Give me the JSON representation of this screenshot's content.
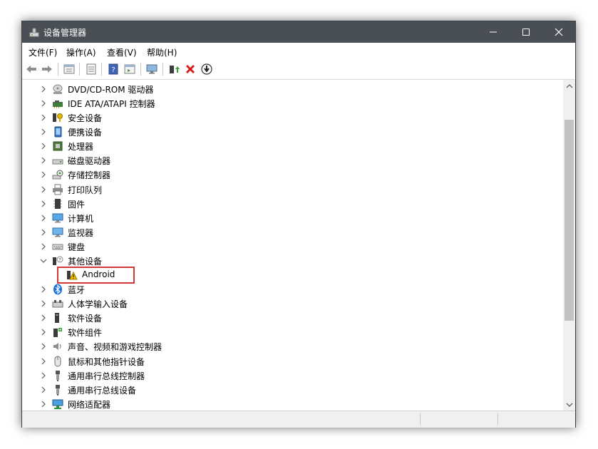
{
  "window": {
    "title": "设备管理器",
    "controls": [
      "minimize",
      "maximize",
      "close"
    ]
  },
  "menu": {
    "items": [
      {
        "label": "文件(F)"
      },
      {
        "label": "操作(A)"
      },
      {
        "label": "查看(V)"
      },
      {
        "label": "帮助(H)"
      }
    ]
  },
  "toolbar": {
    "icons": [
      "back-icon",
      "forward-icon",
      "properties-icon",
      "list-icon",
      "help-icon",
      "show-hide-icon",
      "monitor-scan-icon",
      "update-driver-icon",
      "uninstall-icon",
      "disable-icon"
    ]
  },
  "tree": {
    "items": [
      {
        "label": "DVD/CD-ROM 驱动器",
        "icon": "dvd-drive-icon"
      },
      {
        "label": "IDE ATA/ATAPI 控制器",
        "icon": "ide-controller-icon"
      },
      {
        "label": "安全设备",
        "icon": "security-device-icon"
      },
      {
        "label": "便携设备",
        "icon": "portable-device-icon"
      },
      {
        "label": "处理器",
        "icon": "processor-icon"
      },
      {
        "label": "磁盘驱动器",
        "icon": "disk-drive-icon"
      },
      {
        "label": "存储控制器",
        "icon": "storage-controller-icon"
      },
      {
        "label": "打印队列",
        "icon": "printer-icon"
      },
      {
        "label": "固件",
        "icon": "firmware-icon"
      },
      {
        "label": "计算机",
        "icon": "computer-icon"
      },
      {
        "label": "监视器",
        "icon": "monitor-icon"
      },
      {
        "label": "键盘",
        "icon": "keyboard-icon"
      },
      {
        "label": "其他设备",
        "icon": "other-devices-icon",
        "expanded": true
      },
      {
        "label": "Android",
        "icon": "warning-device-icon",
        "child": true
      },
      {
        "label": "蓝牙",
        "icon": "bluetooth-icon"
      },
      {
        "label": "人体学输入设备",
        "icon": "hid-icon"
      },
      {
        "label": "软件设备",
        "icon": "software-device-icon"
      },
      {
        "label": "软件组件",
        "icon": "software-component-icon"
      },
      {
        "label": "声音、视频和游戏控制器",
        "icon": "sound-icon"
      },
      {
        "label": "鼠标和其他指针设备",
        "icon": "mouse-icon"
      },
      {
        "label": "通用串行总线控制器",
        "icon": "usb-controller-icon"
      },
      {
        "label": "通用串行总线设备",
        "icon": "usb-device-icon"
      },
      {
        "label": "网络适配器",
        "icon": "network-adapter-icon"
      }
    ]
  },
  "colors": {
    "titlebar": "#494f54",
    "highlight": "#d23a3a",
    "scrollbar_thumb": "#c2c2c2"
  }
}
